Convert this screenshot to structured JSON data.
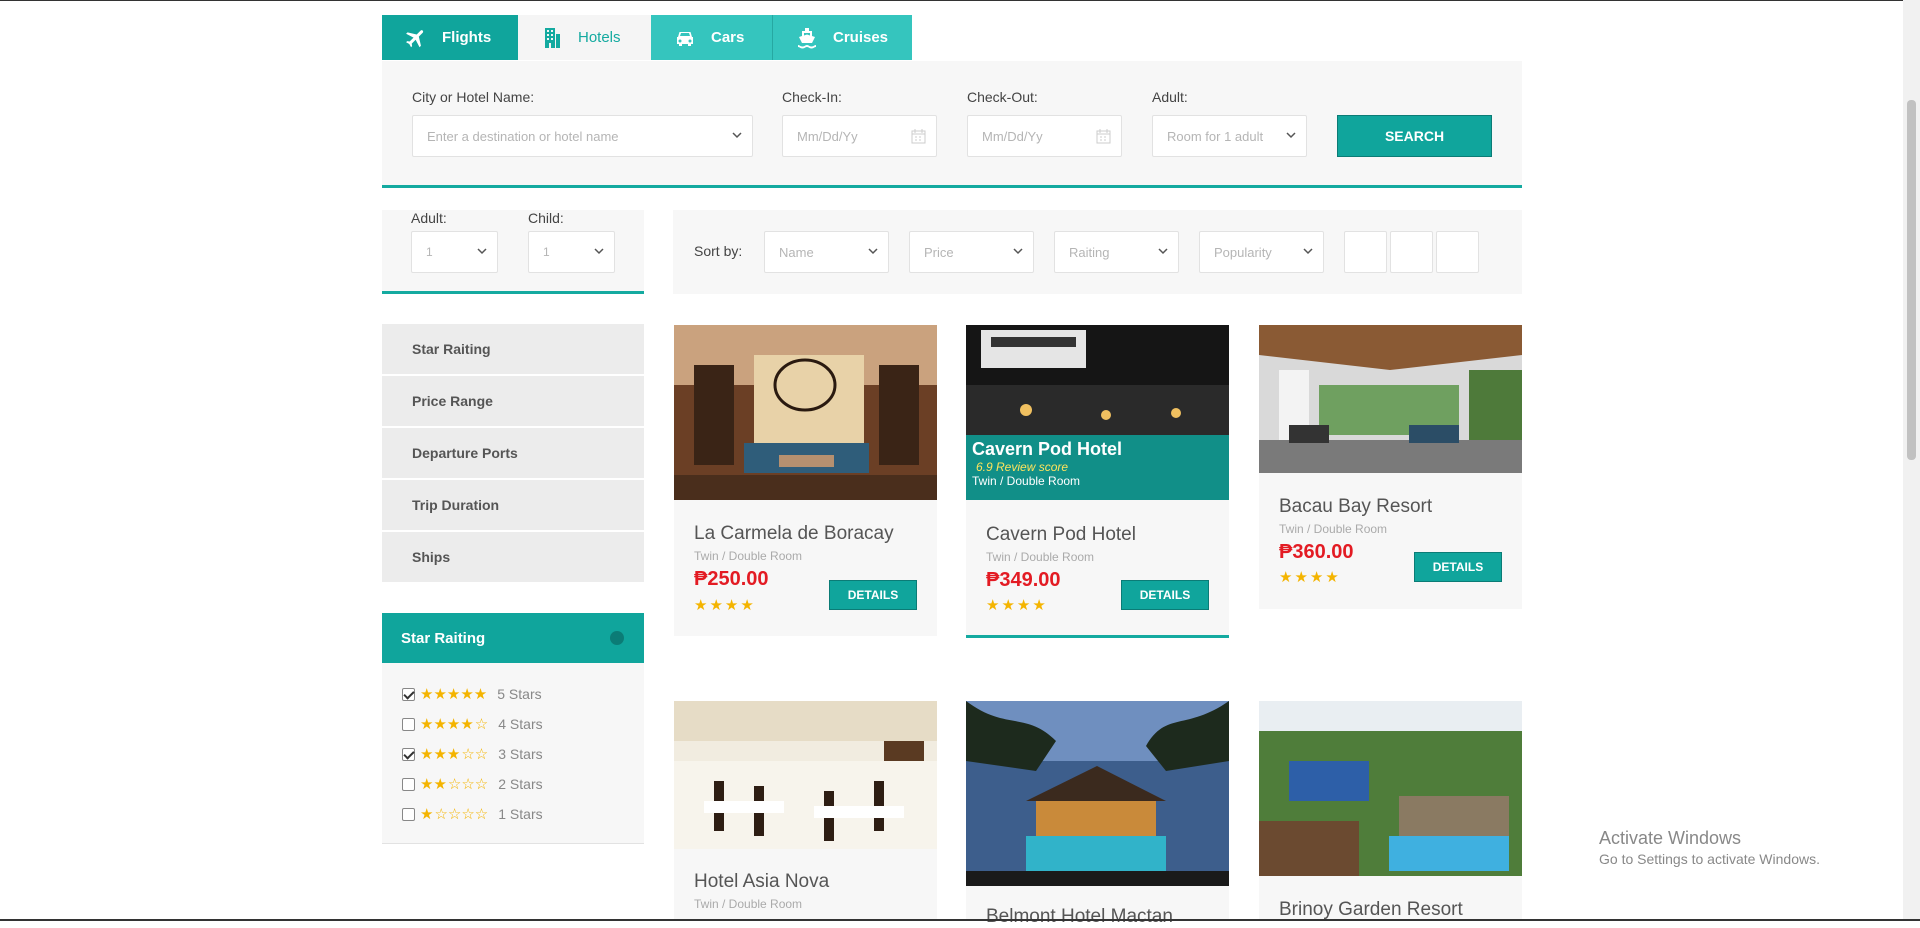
{
  "tabs": {
    "flights": "Flights",
    "hotels": "Hotels",
    "cars": "Cars",
    "cruises": "Cruises"
  },
  "search": {
    "city_label": "City or Hotel Name:",
    "city_placeholder": "Enter a destination or hotel name",
    "checkin_label": "Check-In:",
    "checkin_placeholder": "Mm/Dd/Yy",
    "checkout_label": "Check-Out:",
    "checkout_placeholder": "Mm/Dd/Yy",
    "adult_label": "Adult:",
    "adult_value": "Room for 1 adult",
    "search_button": "SEARCH"
  },
  "guests": {
    "adult_label": "Adult:",
    "adult_value": "1",
    "child_label": "Child:",
    "child_value": "1"
  },
  "sort": {
    "label": "Sort by:",
    "options": [
      "Name",
      "Price",
      "Raiting",
      "Popularity"
    ]
  },
  "filters": {
    "items": [
      "Star Raiting",
      "Price Range",
      "Departure Ports",
      "Trip Duration",
      "Ships"
    ],
    "star_heading": "Star Raiting",
    "star_rows": [
      {
        "label": "5 Stars",
        "stars": 5,
        "checked": true
      },
      {
        "label": "4 Stars",
        "stars": 4,
        "checked": false
      },
      {
        "label": "3 Stars",
        "stars": 3,
        "checked": true
      },
      {
        "label": "2 Stars",
        "stars": 2,
        "checked": false
      },
      {
        "label": "1 Stars",
        "stars": 1,
        "checked": false
      }
    ]
  },
  "hotels": [
    {
      "name": "La Carmela de Boracay",
      "room": "Twin / Double Room",
      "price": "₱250.00",
      "stars": 4,
      "details": "DETAILS"
    },
    {
      "name": "Cavern Pod Hotel",
      "room": "Twin / Double Room",
      "price": "₱349.00",
      "stars": 4,
      "details": "DETAILS",
      "overlay_name": "Cavern Pod Hotel",
      "overlay_score": "6.9 Review score",
      "overlay_room": "Twin / Double Room"
    },
    {
      "name": "Bacau Bay Resort",
      "room": "Twin / Double Room",
      "price": "₱360.00",
      "stars": 4,
      "details": "DETAILS"
    },
    {
      "name": "Hotel Asia Nova",
      "room": "Twin / Double Room"
    },
    {
      "name": "Belmont Hotel Mactan"
    },
    {
      "name": "Brinoy Garden Resort"
    }
  ],
  "watermark": {
    "line1": "Activate Windows",
    "line2": "Go to Settings to activate Windows."
  },
  "colors": {
    "accent": "#10a59c",
    "accent_light": "#35c5be",
    "price": "#e31b23",
    "star": "#f4b400"
  }
}
